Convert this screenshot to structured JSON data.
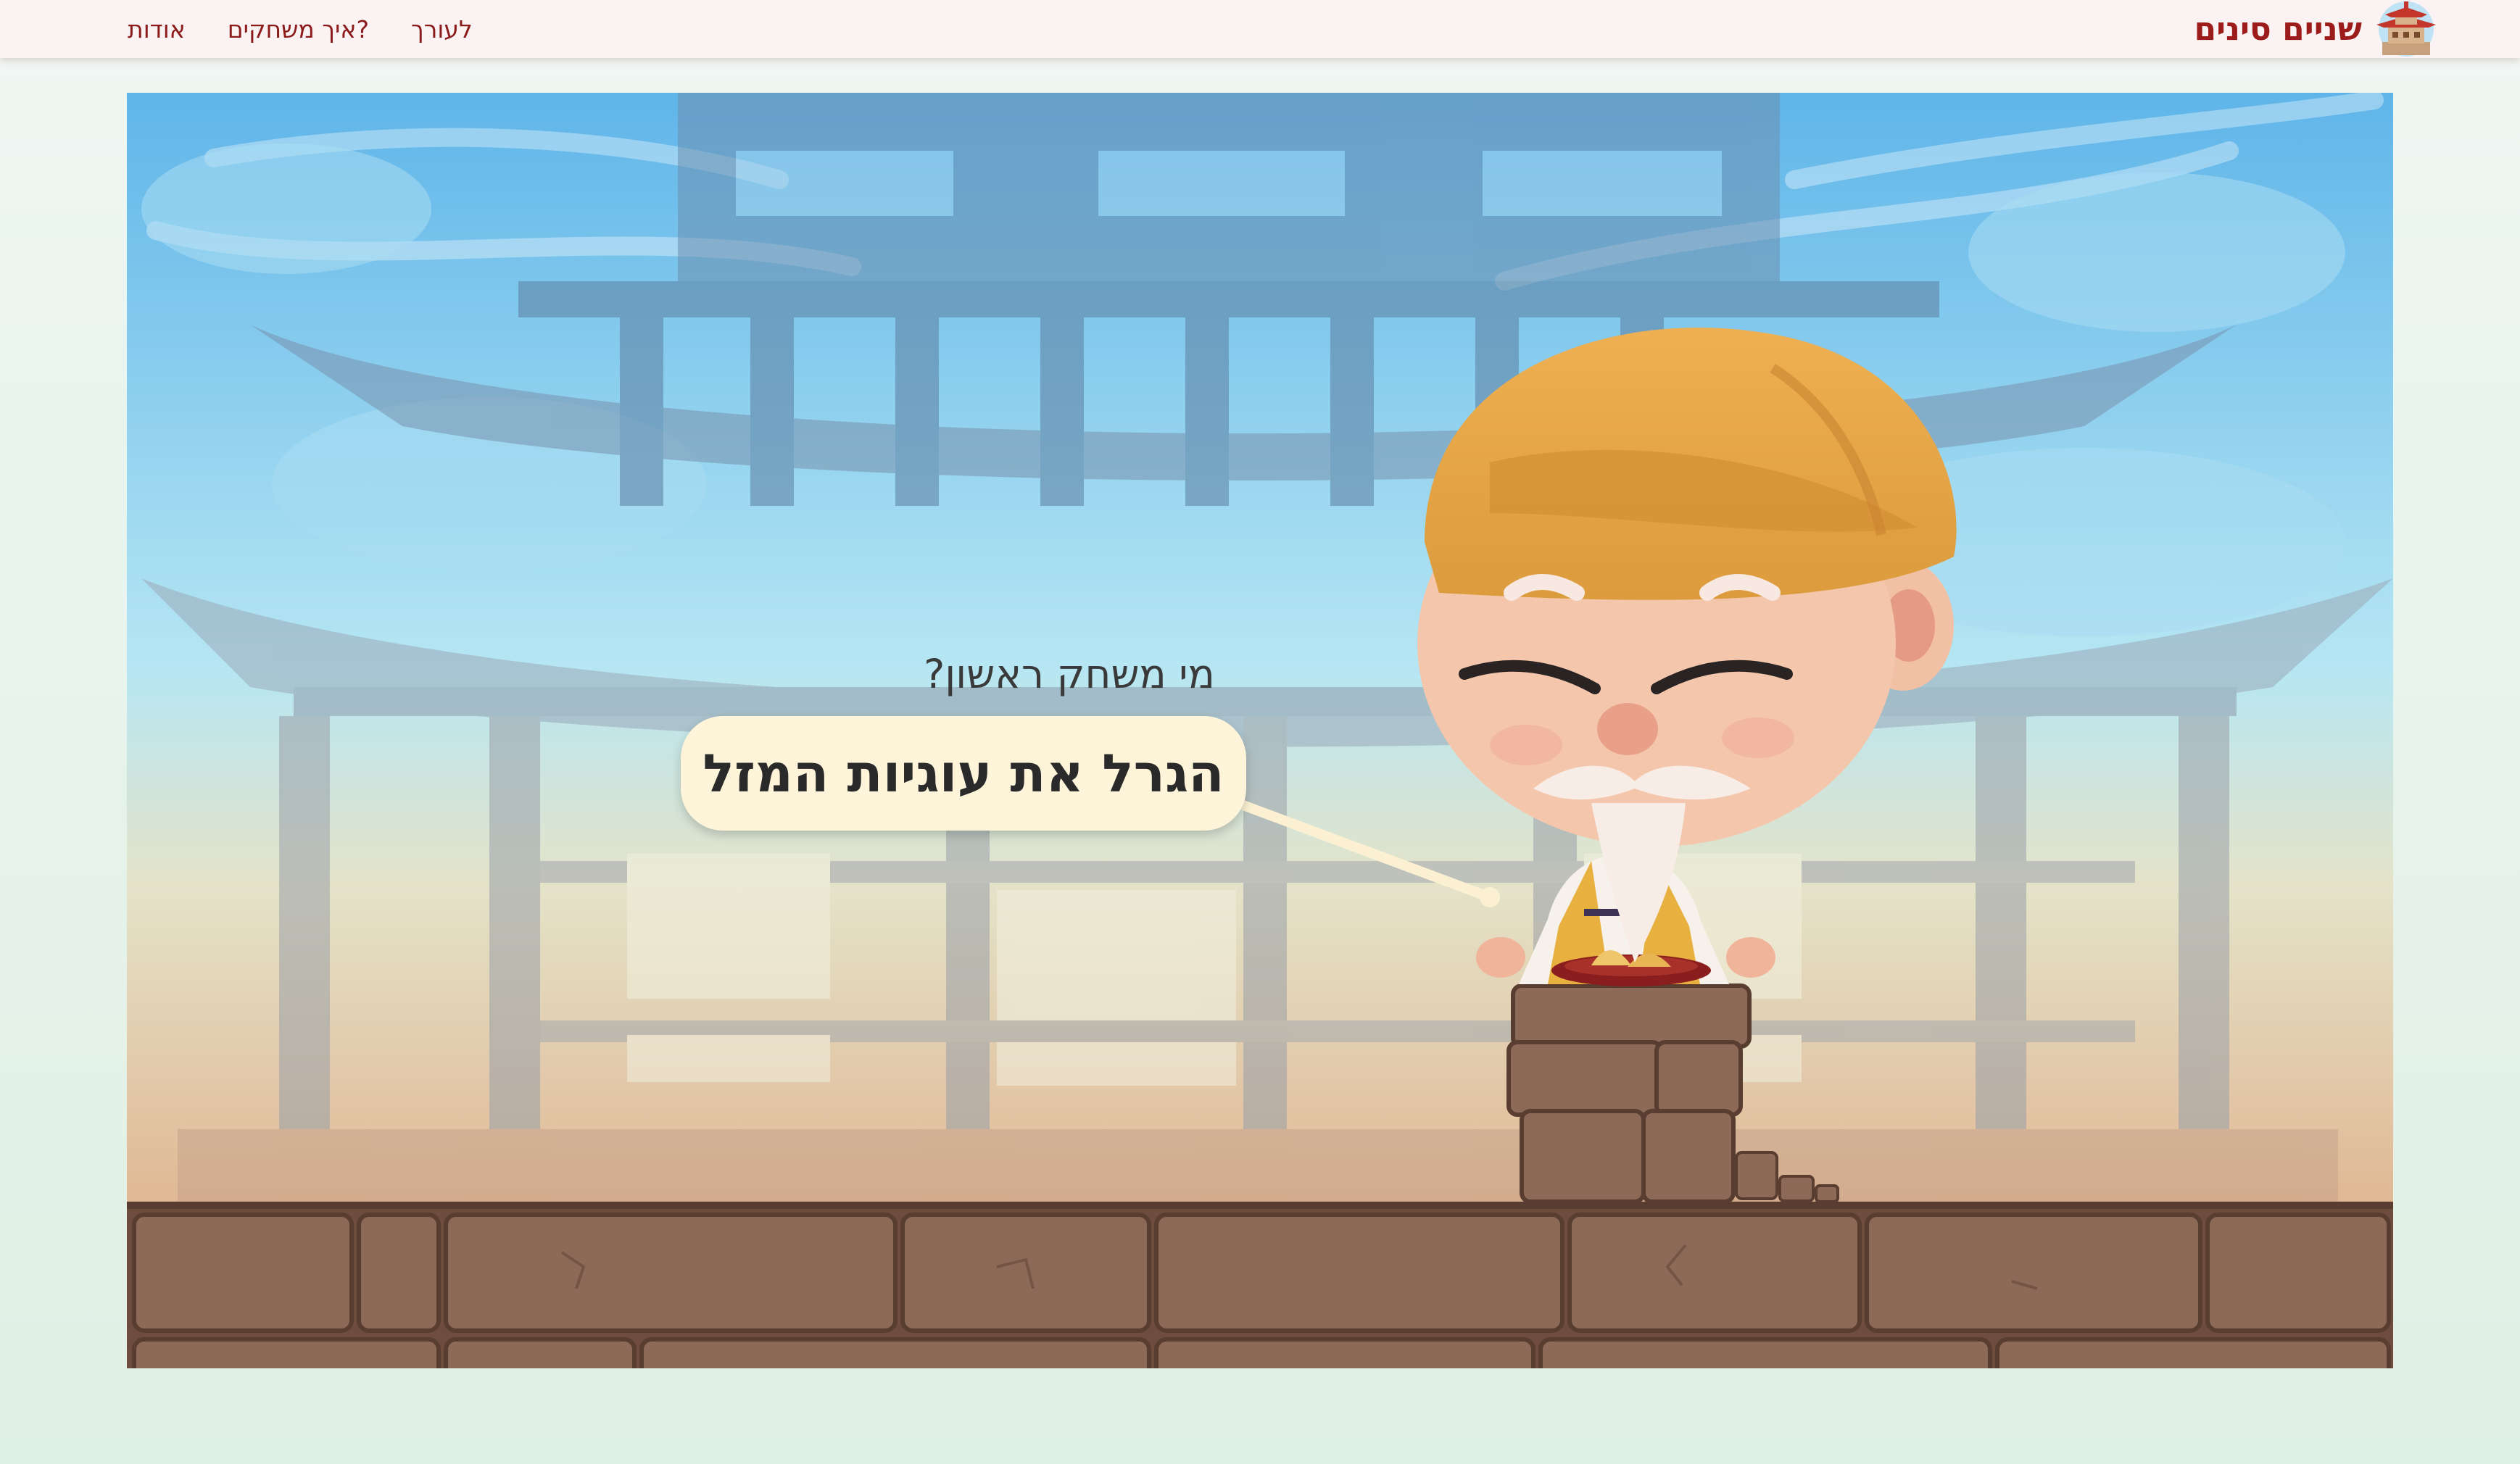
{
  "brand": {
    "name": "שניים סינים",
    "logo_icon": "pagoda-logo-icon"
  },
  "nav": {
    "items": [
      {
        "label": "אודות"
      },
      {
        "label": "איך משחקים?"
      },
      {
        "label": "לעורך"
      }
    ]
  },
  "game": {
    "question": "מי משחק ראשון?",
    "cta_label": "הגרל את עוגיות המזל"
  },
  "colors": {
    "accent": "#9c1c1c",
    "nav_text": "#8b1a1a",
    "button_bg": "#fdf4da",
    "hat": "#e8a94a",
    "ground": "#7e5a4a"
  }
}
